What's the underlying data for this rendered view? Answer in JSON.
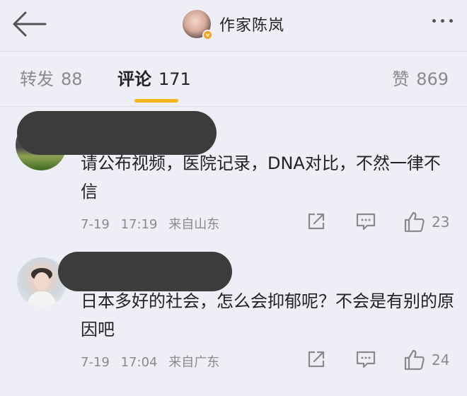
{
  "header": {
    "back_icon": "arrow-left-icon",
    "author_name": "作家陈岚",
    "verified_badge": "v",
    "more_icon": "more-horizontal-icon"
  },
  "tabs": [
    {
      "label": "转发",
      "count": "88",
      "active": false
    },
    {
      "label": "评论",
      "count": "171",
      "active": true
    },
    {
      "label": "赞",
      "count": "869",
      "active": false
    }
  ],
  "colors": {
    "background": "#eeeef6",
    "active_underline": "#f5b51a",
    "verified_badge": "#f7a21b",
    "muted_text": "#8a8a8a"
  },
  "comments": [
    {
      "text": "请公布视频，医院记录，DNA对比，不然一律不信",
      "date": "7-19",
      "time": "17:19",
      "location": "来自山东",
      "likes": "23"
    },
    {
      "text": "日本多好的社会，怎么会抑郁呢？不会是有别的原因吧",
      "date": "7-19",
      "time": "17:04",
      "location": "来自广东",
      "likes": "24"
    }
  ]
}
